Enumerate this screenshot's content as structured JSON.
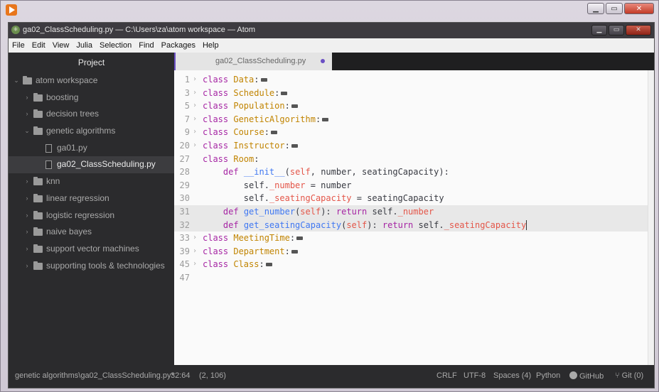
{
  "window": {
    "title": "ga02_ClassScheduling.py — C:\\Users\\za\\atom workspace — Atom"
  },
  "menu": [
    "File",
    "Edit",
    "View",
    "Julia",
    "Selection",
    "Find",
    "Packages",
    "Help"
  ],
  "sidebar": {
    "title": "Project",
    "tree": [
      {
        "label": "atom workspace",
        "type": "folder",
        "depth": 0,
        "expanded": true
      },
      {
        "label": "boosting",
        "type": "folder",
        "depth": 1,
        "expanded": false
      },
      {
        "label": "decision trees",
        "type": "folder",
        "depth": 1,
        "expanded": false
      },
      {
        "label": "genetic algorithms",
        "type": "folder",
        "depth": 1,
        "expanded": true
      },
      {
        "label": "ga01.py",
        "type": "file",
        "depth": 2
      },
      {
        "label": "ga02_ClassScheduling.py",
        "type": "file",
        "depth": 2,
        "selected": true
      },
      {
        "label": "knn",
        "type": "folder",
        "depth": 1,
        "expanded": false
      },
      {
        "label": "linear regression",
        "type": "folder",
        "depth": 1,
        "expanded": false
      },
      {
        "label": "logistic regression",
        "type": "folder",
        "depth": 1,
        "expanded": false
      },
      {
        "label": "naive bayes",
        "type": "folder",
        "depth": 1,
        "expanded": false
      },
      {
        "label": "support vector machines",
        "type": "folder",
        "depth": 1,
        "expanded": false
      },
      {
        "label": "supporting tools & technologies",
        "type": "folder",
        "depth": 1,
        "expanded": false
      }
    ]
  },
  "editor": {
    "tab": {
      "title": "ga02_ClassScheduling.py",
      "modified": true
    },
    "lines": [
      {
        "num": "1",
        "fold": "›",
        "tokens": [
          [
            "kw",
            "class "
          ],
          [
            "cls",
            "Data"
          ],
          [
            "p",
            ":"
          ],
          [
            "fold",
            ""
          ]
        ]
      },
      {
        "num": "3",
        "fold": "›",
        "tokens": [
          [
            "kw",
            "class "
          ],
          [
            "cls",
            "Schedule"
          ],
          [
            "p",
            ":"
          ],
          [
            "fold",
            ""
          ]
        ]
      },
      {
        "num": "5",
        "fold": "›",
        "tokens": [
          [
            "kw",
            "class "
          ],
          [
            "cls",
            "Population"
          ],
          [
            "p",
            ":"
          ],
          [
            "fold",
            ""
          ]
        ]
      },
      {
        "num": "7",
        "fold": "›",
        "tokens": [
          [
            "kw",
            "class "
          ],
          [
            "cls",
            "GeneticAlgorithm"
          ],
          [
            "p",
            ":"
          ],
          [
            "fold",
            ""
          ]
        ]
      },
      {
        "num": "9",
        "fold": "›",
        "tokens": [
          [
            "kw",
            "class "
          ],
          [
            "cls",
            "Course"
          ],
          [
            "p",
            ":"
          ],
          [
            "fold",
            ""
          ]
        ]
      },
      {
        "num": "20",
        "fold": "›",
        "tokens": [
          [
            "kw",
            "class "
          ],
          [
            "cls",
            "Instructor"
          ],
          [
            "p",
            ":"
          ],
          [
            "fold",
            ""
          ]
        ]
      },
      {
        "num": "27",
        "fold": "",
        "tokens": [
          [
            "kw",
            "class "
          ],
          [
            "cls",
            "Room"
          ],
          [
            "p",
            ":"
          ]
        ]
      },
      {
        "num": "28",
        "fold": "",
        "tokens": [
          [
            "p",
            "    "
          ],
          [
            "kw",
            "def "
          ],
          [
            "fn",
            "__init__"
          ],
          [
            "p",
            "("
          ],
          [
            "self",
            "self"
          ],
          [
            "p",
            ", number, seatingCapacity):"
          ]
        ]
      },
      {
        "num": "29",
        "fold": "",
        "tokens": [
          [
            "p",
            "        self."
          ],
          [
            "attr",
            "_number"
          ],
          [
            "p",
            " = number"
          ]
        ]
      },
      {
        "num": "30",
        "fold": "",
        "tokens": [
          [
            "p",
            "        self."
          ],
          [
            "attr",
            "_seatingCapacity"
          ],
          [
            "p",
            " = seatingCapacity"
          ]
        ]
      },
      {
        "num": "31",
        "fold": "",
        "hl": true,
        "tokens": [
          [
            "p",
            "    "
          ],
          [
            "kw",
            "def "
          ],
          [
            "fn",
            "get_number"
          ],
          [
            "p",
            "("
          ],
          [
            "self",
            "self"
          ],
          [
            "p",
            "): "
          ],
          [
            "kw",
            "return "
          ],
          [
            "p",
            "self."
          ],
          [
            "attr",
            "_number"
          ]
        ]
      },
      {
        "num": "32",
        "fold": "",
        "hl": true,
        "tokens": [
          [
            "p",
            "    "
          ],
          [
            "kw",
            "def "
          ],
          [
            "fn",
            "get_seatingCapacity"
          ],
          [
            "p",
            "("
          ],
          [
            "self",
            "self"
          ],
          [
            "p",
            "): "
          ],
          [
            "kw",
            "return "
          ],
          [
            "p",
            "self."
          ],
          [
            "attr",
            "_seatingCapacity"
          ],
          [
            "cursor",
            ""
          ]
        ]
      },
      {
        "num": "33",
        "fold": "›",
        "tokens": [
          [
            "kw",
            "class "
          ],
          [
            "cls",
            "MeetingTime"
          ],
          [
            "p",
            ":"
          ],
          [
            "fold",
            ""
          ]
        ]
      },
      {
        "num": "39",
        "fold": "›",
        "tokens": [
          [
            "kw",
            "class "
          ],
          [
            "cls",
            "Department"
          ],
          [
            "p",
            ":"
          ],
          [
            "fold",
            ""
          ]
        ]
      },
      {
        "num": "45",
        "fold": "›",
        "tokens": [
          [
            "kw",
            "class "
          ],
          [
            "cls",
            "Class"
          ],
          [
            "p",
            ":"
          ],
          [
            "fold",
            ""
          ]
        ]
      },
      {
        "num": "47",
        "fold": "",
        "tokens": []
      }
    ]
  },
  "status": {
    "path": "genetic algorithms\\ga02_ClassScheduling.py*",
    "cursor": "32:64",
    "selection": "(2, 106)",
    "line_ending": "CRLF",
    "encoding": "UTF-8",
    "indent": "Spaces (4)",
    "grammar": "Python",
    "github": "GitHub",
    "git": "Git (0)"
  }
}
